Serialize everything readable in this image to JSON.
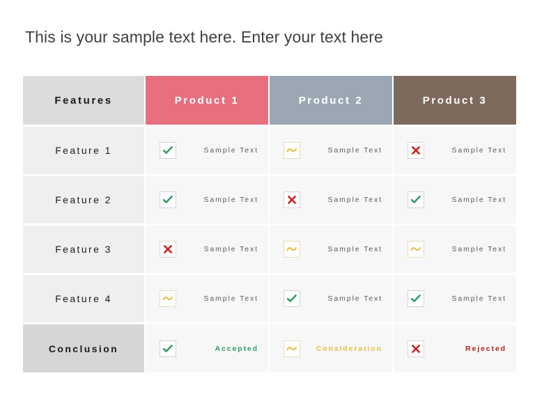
{
  "slide": {
    "title": "This is your sample text here. Enter your text here"
  },
  "colors": {
    "product1_header": "#e8707e",
    "product2_header": "#9ba8b4",
    "product3_header": "#7d6a5c",
    "features_header": "#dcdcdc",
    "check": "#2e9e62",
    "tilde": "#e8c04a",
    "cross": "#cc2222",
    "accepted_text": "#2e9e62",
    "consideration_text": "#e8bc3f",
    "rejected_text": "#b52121"
  },
  "table": {
    "headers": {
      "features": "Features",
      "product1": "Product 1",
      "product2": "Product 2",
      "product3": "Product 3"
    },
    "rows": [
      {
        "label": "Feature 1",
        "cells": [
          {
            "icon": "check-icon",
            "text": "Sample Text"
          },
          {
            "icon": "tilde-icon",
            "text": "Sample Text"
          },
          {
            "icon": "cross-icon",
            "text": "Sample Text"
          }
        ]
      },
      {
        "label": "Feature 2",
        "cells": [
          {
            "icon": "check-icon",
            "text": "Sample Text"
          },
          {
            "icon": "cross-icon",
            "text": "Sample Text"
          },
          {
            "icon": "check-icon",
            "text": "Sample Text"
          }
        ]
      },
      {
        "label": "Feature 3",
        "cells": [
          {
            "icon": "cross-icon",
            "text": "Sample Text"
          },
          {
            "icon": "tilde-icon",
            "text": "Sample Text"
          },
          {
            "icon": "tilde-icon",
            "text": "Sample Text"
          }
        ]
      },
      {
        "label": "Feature 4",
        "cells": [
          {
            "icon": "tilde-icon",
            "text": "Sample Text"
          },
          {
            "icon": "check-icon",
            "text": "Sample Text"
          },
          {
            "icon": "check-icon",
            "text": "Sample Text"
          }
        ]
      },
      {
        "label": "Conclusion",
        "cells": [
          {
            "icon": "check-icon",
            "text": "Accepted"
          },
          {
            "icon": "tilde-icon",
            "text": "Consideration"
          },
          {
            "icon": "cross-icon",
            "text": "Rejected"
          }
        ]
      }
    ]
  }
}
